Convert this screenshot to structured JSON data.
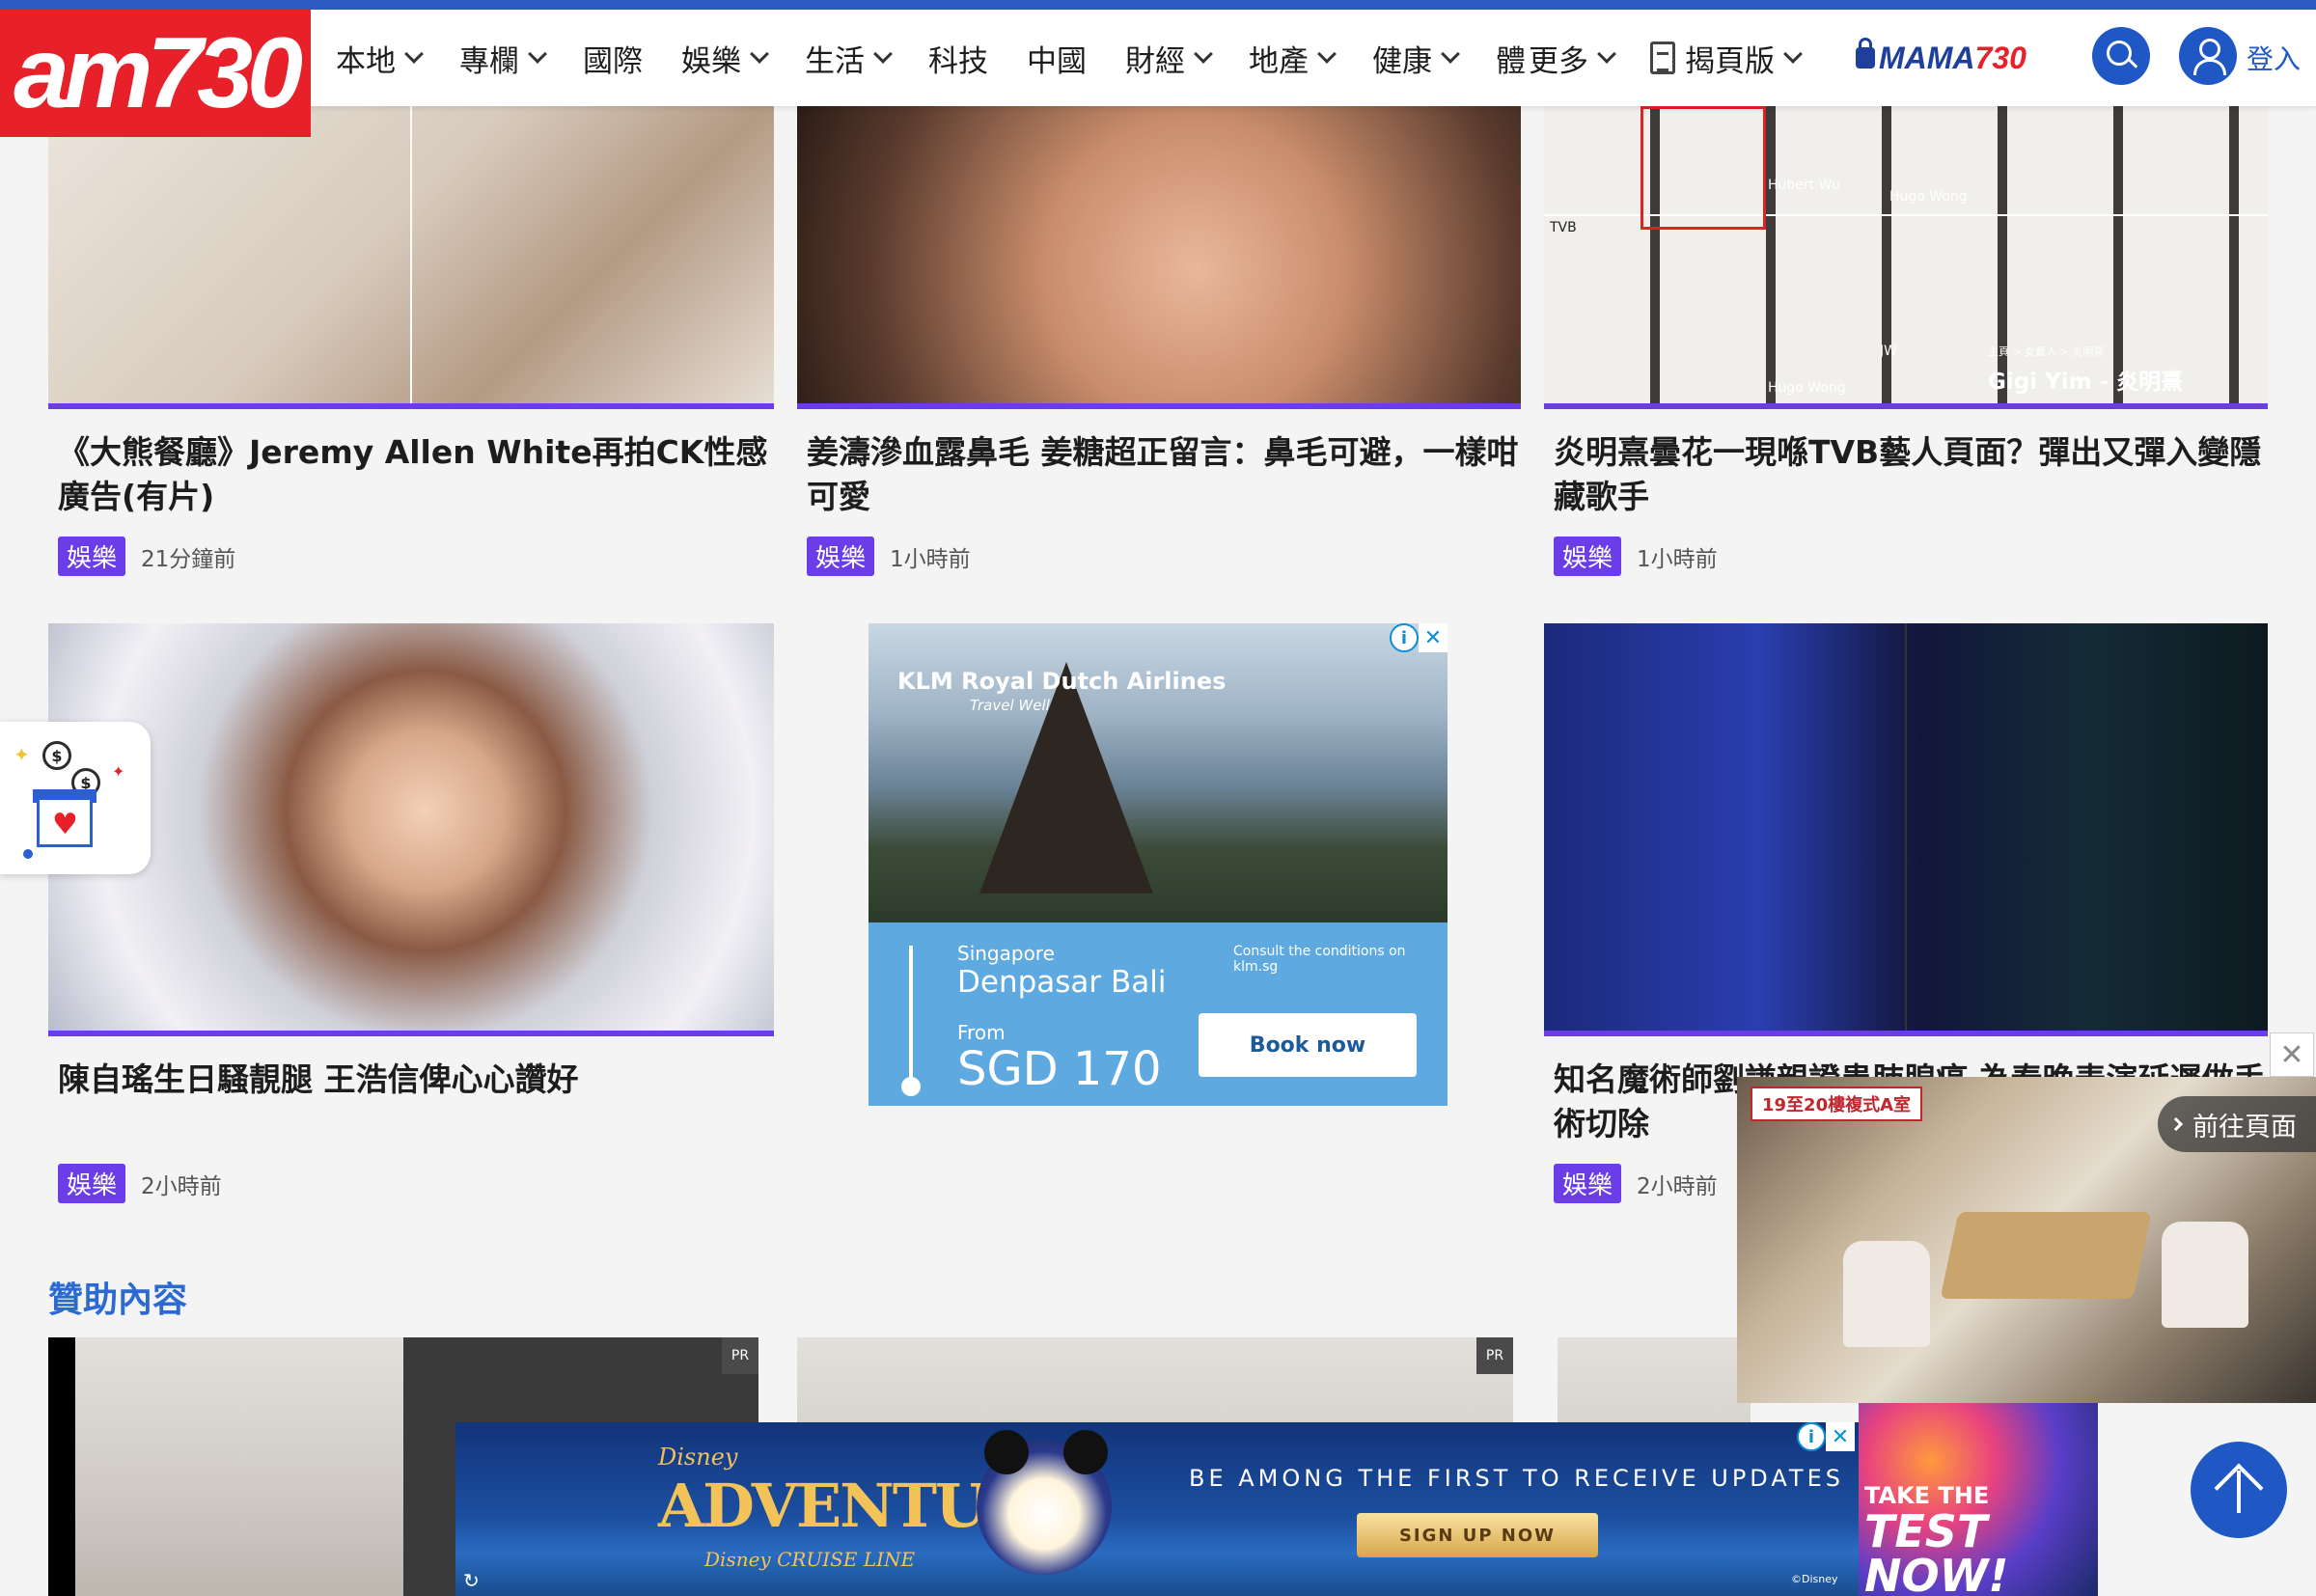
{
  "site": {
    "logo_text": "am730",
    "nav": [
      {
        "label": "本地"
      },
      {
        "label": "專欄"
      },
      {
        "label": "國際"
      },
      {
        "label": "娛樂"
      },
      {
        "label": "生活"
      },
      {
        "label": "科技"
      },
      {
        "label": "中國"
      },
      {
        "label": "財經"
      },
      {
        "label": "地產"
      },
      {
        "label": "健康"
      },
      {
        "label": "體"
      }
    ],
    "nav_right": {
      "more": "更多",
      "epaper": "揭頁版",
      "mama_logo_a": "MAMA",
      "mama_logo_b": "730",
      "login": "登入"
    },
    "accent_color": "#6a3de8",
    "brand_color": "#e8202a",
    "link_color": "#1f57c4"
  },
  "articles": [
    {
      "title": "《大熊餐廳》Jeremy Allen White再拍CK性感廣告(有片)",
      "category": "娛樂",
      "time": "21分鐘前"
    },
    {
      "title": "姜濤滲血露鼻毛 姜糖超正留言：鼻毛可避，一樣咁可愛",
      "category": "娛樂",
      "time": "1小時前"
    },
    {
      "title": "炎明熹曇花一現喺TVB藝人頁面？彈出又彈入變隱藏歌手",
      "category": "娛樂",
      "time": "1小時前",
      "image_labels": [
        "Hubert Wu",
        "Hugo Wong",
        "TVB",
        "Hugo Wong",
        "JW",
        "主頁 > 女藝人 > 炎明熹",
        "Gigi Yim - 炎明熹"
      ]
    },
    {
      "title": "陳自瑤生日騷靚腿 王浩信俾心心讚好",
      "category": "娛樂",
      "time": "2小時前"
    },
    {
      "title": "知名魔術師劉謙親證患肺腺癌 為春晚表演延遲做手術切除",
      "category": "娛樂",
      "time": "2小時前"
    }
  ],
  "klm_ad": {
    "brand": "KLM Royal Dutch Airlines",
    "tagline": "Travel Well",
    "from_city": "Singapore",
    "to_city": "Denpasar Bali",
    "from_label": "From",
    "price": "SGD 170",
    "conditions": "Consult the conditions on klm.sg",
    "cta": "Book now",
    "info_icon": "i",
    "close_icon": "✕"
  },
  "sponsored": {
    "heading": "贊助內容",
    "pr_tag": "PR"
  },
  "video_popup": {
    "label": "19至20樓複式A室",
    "goto": "前往頁面",
    "close": "✕"
  },
  "disney_ad": {
    "brand": "Disney",
    "title": "ADVENTURE",
    "line": "Disney CRUISE LINE",
    "cta_text": "BE AMONG THE FIRST TO RECEIVE UPDATES",
    "signup": "SIGN UP NOW",
    "copyright": "©Disney"
  },
  "brain_ad": {
    "line1": "TAKE THE",
    "line2": "TEST NOW!"
  }
}
